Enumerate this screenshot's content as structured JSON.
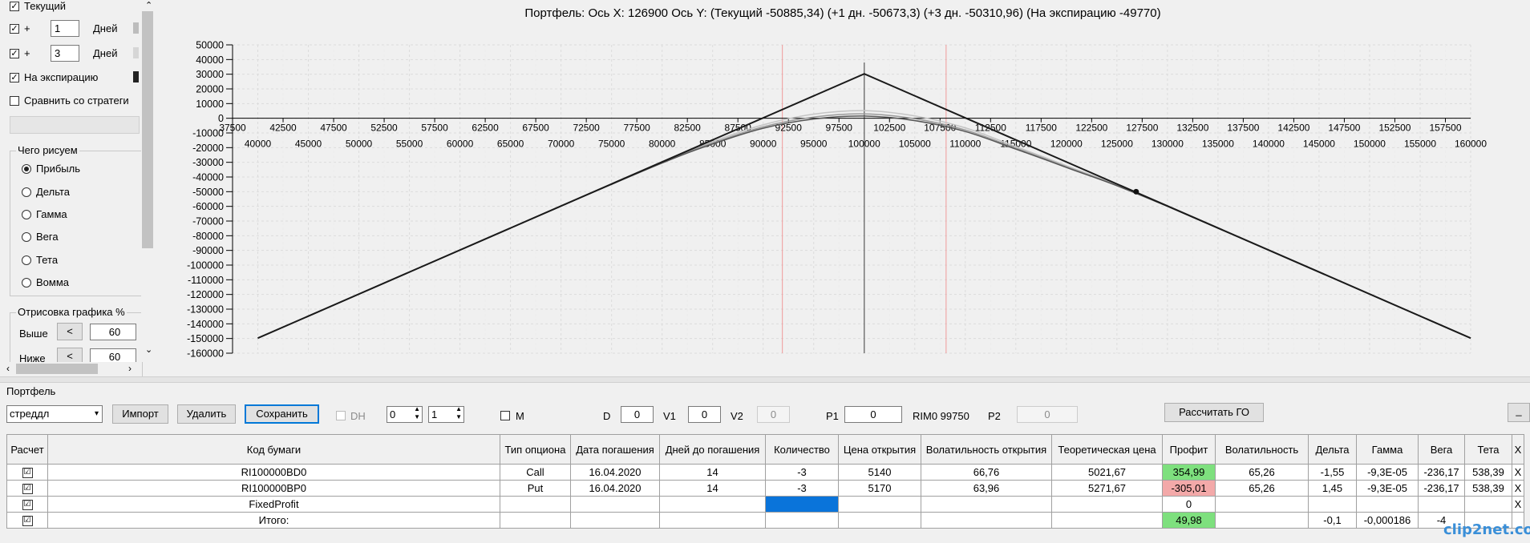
{
  "left_panel": {
    "current_label": "Текущий",
    "plus1": {
      "sign": "+",
      "value": "1",
      "unit": "Дней"
    },
    "plus3": {
      "sign": "+",
      "value": "3",
      "unit": "Дней"
    },
    "expiration_label": "На экспирацию",
    "compare_label": "Сравнить со стратеги",
    "what_group_title": "Чего рисуем",
    "radio_options": [
      "Прибыль",
      "Дельта",
      "Гамма",
      "Вега",
      "Тета",
      "Вомма"
    ],
    "selected_radio": "Прибыль",
    "draw_group_title": "Отрисовка графика %",
    "above_label": "Выше",
    "above_value": "60",
    "below_label": "Ниже",
    "below_value": "60",
    "arrow_btn": "<",
    "legend_colors": {
      "current": "#555555",
      "plus1": "#aaaaaa",
      "plus3": "#cccccc",
      "expiration": "#222222"
    }
  },
  "chart_data": {
    "type": "line",
    "title": "Портфель: Ось X: 126900 Ось Y:  (Текущий -50885,34)  (+1 дн. -50673,3)  (+3 дн. -50310,96)  (На экспирацию -49770)",
    "xlim": [
      37500,
      160000
    ],
    "ylim": [
      -160000,
      50000
    ],
    "yticks": [
      50000,
      40000,
      30000,
      20000,
      10000,
      0,
      -10000,
      -20000,
      -30000,
      -40000,
      -50000,
      -60000,
      -70000,
      -80000,
      -90000,
      -100000,
      -110000,
      -120000,
      -130000,
      -140000,
      -150000,
      -160000
    ],
    "xticks_top": [
      37500,
      42500,
      47500,
      52500,
      57500,
      62500,
      67500,
      72500,
      77500,
      82500,
      87500,
      92500,
      97500,
      102500,
      107500,
      112500,
      117500,
      122500,
      127500,
      132500,
      137500,
      142500,
      147500,
      152500,
      157500
    ],
    "xticks_bottom": [
      40000,
      45000,
      50000,
      55000,
      60000,
      65000,
      70000,
      75000,
      80000,
      85000,
      90000,
      95000,
      100000,
      105000,
      110000,
      115000,
      120000,
      125000,
      130000,
      135000,
      140000,
      145000,
      150000,
      155000,
      160000
    ],
    "vlines_red": [
      91900,
      108100
    ],
    "vline_center": 100000,
    "marker": {
      "x": 126900,
      "y": -50000
    },
    "series": [
      {
        "name": "На экспирацию",
        "color": "#1a1a1a",
        "x": [
          40000,
          100000,
          160000
        ],
        "y": [
          -149750,
          30250,
          -149750
        ]
      },
      {
        "name": "Текущий",
        "color": "#555555",
        "x": [
          40000,
          70000,
          80000,
          85000,
          90000,
          95000,
          100000,
          105000,
          110000,
          115000,
          120000,
          130000,
          160000
        ],
        "y": [
          -149750,
          -59900,
          -30500,
          -17500,
          -6800,
          -500,
          1500,
          -1600,
          -9000,
          -21000,
          -33500,
          -60000,
          -149750
        ]
      },
      {
        "name": "+1 дн.",
        "color": "#9a9a9a",
        "x": [
          40000,
          70000,
          80000,
          85000,
          90000,
          95000,
          100000,
          105000,
          110000,
          115000,
          120000,
          130000,
          160000
        ],
        "y": [
          -149750,
          -59800,
          -30200,
          -16800,
          -5800,
          800,
          3000,
          -300,
          -8000,
          -20300,
          -33000,
          -59800,
          -149750
        ]
      },
      {
        "name": "+3 дн.",
        "color": "#c4c4c4",
        "x": [
          40000,
          70000,
          80000,
          85000,
          90000,
          95000,
          100000,
          105000,
          110000,
          115000,
          120000,
          130000,
          160000
        ],
        "y": [
          -149750,
          -59700,
          -29800,
          -15900,
          -4500,
          2800,
          5200,
          1600,
          -6500,
          -19300,
          -32300,
          -59500,
          -149750
        ]
      }
    ]
  },
  "portfolio": {
    "group_label": "Портфель",
    "strategy_select": "стреддл",
    "import_btn": "Импорт",
    "delete_btn": "Удалить",
    "save_btn": "Сохранить",
    "dh_label": "DH",
    "spin1": "0",
    "spin2": "1",
    "m_label": "M",
    "d_label": "D",
    "d_value": "0",
    "v1_label": "V1",
    "v1_value": "0",
    "v2_label": "V2",
    "v2_value": "0",
    "p1_label": "P1",
    "p1_value": "0",
    "rim_text": "RIM0 99750",
    "p2_label": "P2",
    "p2_value": "0",
    "calc_go_btn": "Рассчитать ГО",
    "minimize_btn": "_",
    "columns": [
      "Расчет",
      "Код бумаги",
      "Тип опциона",
      "Дата погашения",
      "Дней до погашения",
      "Количество",
      "Цена открытия",
      "Волатильность открытия",
      "Теоретическая цена",
      "Профит",
      "Волатильность",
      "Дельта",
      "Гамма",
      "Вега",
      "Тета",
      "X"
    ],
    "rows": [
      {
        "check": "☑",
        "code": "RI100000BD0",
        "type": "Call",
        "date": "16.04.2020",
        "days": "14",
        "qty": "-3",
        "price": "5140",
        "vol_open": "66,76",
        "theo": "5021,67",
        "profit": "354,99",
        "vol": "65,26",
        "delta": "-1,55",
        "gamma": "-9,3E-05",
        "vega": "-236,17",
        "theta": "538,39",
        "x": "X",
        "profit_color": "#7ee07e"
      },
      {
        "check": "☑",
        "code": "RI100000BP0",
        "type": "Put",
        "date": "16.04.2020",
        "days": "14",
        "qty": "-3",
        "price": "5170",
        "vol_open": "63,96",
        "theo": "5271,67",
        "profit": "-305,01",
        "vol": "65,26",
        "delta": "1,45",
        "gamma": "-9,3E-05",
        "vega": "-236,17",
        "theta": "538,39",
        "x": "X",
        "profit_color": "#f3a9a9"
      },
      {
        "check": "☑",
        "code": "FixedProfit",
        "type": "",
        "date": "",
        "days": "",
        "qty": "",
        "price": "",
        "vol_open": "",
        "theo": "",
        "profit": "0",
        "vol": "",
        "delta": "",
        "gamma": "",
        "vega": "",
        "theta": "",
        "x": "X",
        "profit_color": "#ffffff",
        "qty_color": "#0a74da"
      },
      {
        "check": "☑",
        "code": "Итого:",
        "type": "",
        "date": "",
        "days": "",
        "qty": "",
        "price": "",
        "vol_open": "",
        "theo": "",
        "profit": "49,98",
        "vol": "",
        "delta": "-0,1",
        "gamma": "-0,000186",
        "vega": "-4",
        "theta": "",
        "x": "",
        "profit_color": "#7ee07e"
      }
    ]
  },
  "watermark": "clip2net.com"
}
